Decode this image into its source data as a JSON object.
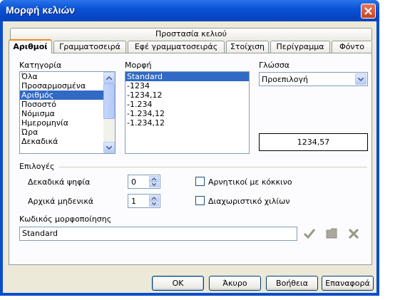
{
  "window": {
    "title": "Μορφή κελιών"
  },
  "tabs_top": [
    {
      "label": "Προστασία κελιού"
    }
  ],
  "tabs_bottom": [
    {
      "label": "Αριθμοί",
      "active": true
    },
    {
      "label": "Γραμματοσειρά"
    },
    {
      "label": "Εφέ γραμματοσειράς"
    },
    {
      "label": "Στοίχιση"
    },
    {
      "label": "Περίγραμμα"
    },
    {
      "label": "Φόντο"
    }
  ],
  "category": {
    "label": "Κατηγορία",
    "items": [
      "Όλα",
      "Προσαρμοσμένα",
      "Αριθμός",
      "Ποσοστό",
      "Νόμισμα",
      "Ημερομηνία",
      "Ώρα",
      "Δεκαδικά"
    ],
    "selected": "Αριθμός"
  },
  "format": {
    "label": "Μορφή",
    "items": [
      "Standard",
      "-1234",
      "-1234,12",
      "-1.234",
      "-1.234,12",
      "-1.234,12"
    ],
    "selected": "Standard"
  },
  "language": {
    "label": "Γλώσσα",
    "value": "Προεπιλογή"
  },
  "preview": {
    "value": "1234,57"
  },
  "options": {
    "label": "Επιλογές",
    "decimal_places_label": "Δεκαδικά ψηφία",
    "decimal_places_value": "0",
    "leading_zeros_label": "Αρχικά μηδενικά",
    "leading_zeros_value": "1",
    "negative_red_label": "Αρνητικοί με κόκκινο",
    "negative_red_checked": false,
    "thousands_sep_label": "Διαχωριστικό χιλίων",
    "thousands_sep_checked": false
  },
  "format_code": {
    "label": "Κωδικός μορφοποίησης",
    "value": "Standard"
  },
  "buttons": {
    "ok": "OK",
    "cancel": "Άκυρο",
    "help": "Βοήθεια",
    "reset": "Επαναφορά"
  }
}
